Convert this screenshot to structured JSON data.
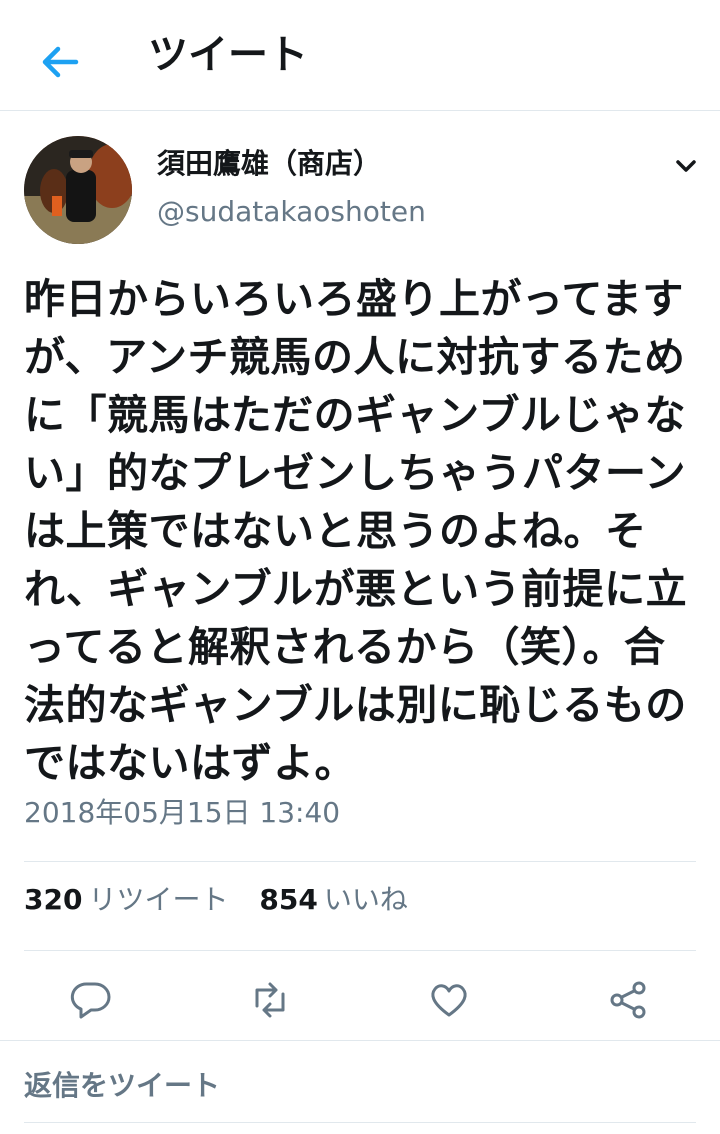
{
  "header": {
    "title": "ツイート",
    "back_icon": "arrow-left-icon"
  },
  "author": {
    "name": "須田鷹雄（商店）",
    "handle": "@sudatakaoshoten",
    "menu_icon": "chevron-down-icon"
  },
  "tweet": {
    "text": "昨日からいろいろ盛り上がってますが、アンチ競馬の人に対抗するために「競馬はただのギャンブルじゃない」的なプレゼンしちゃうパターンは上策ではないと思うのよね。それ、ギャンブルが悪という前提に立ってると解釈されるから（笑）。合法的なギャンブルは別に恥じるものではないはずよ。",
    "timestamp": "2018年05月15日 13:40"
  },
  "stats": {
    "retweets_count": "320",
    "retweets_label": "リツイート",
    "likes_count": "854",
    "likes_label": "いいね"
  },
  "actions": [
    "reply-icon",
    "retweet-icon",
    "heart-icon",
    "share-icon"
  ],
  "reply_prompt": "返信をツイート",
  "colors": {
    "accent": "#1da1f2",
    "muted": "#657786",
    "divider": "#e1e8ed"
  }
}
